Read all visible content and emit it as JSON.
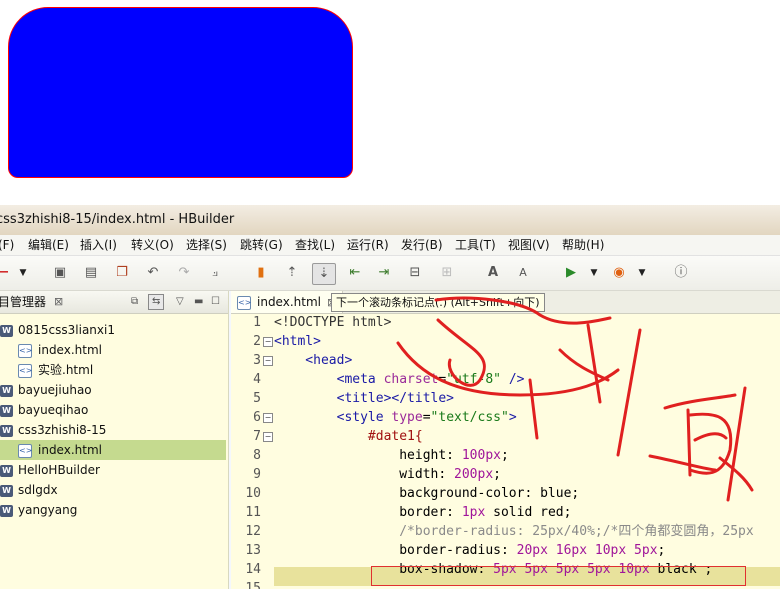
{
  "window": {
    "title": "css3zhishi8-15/index.html  -  HBuilder"
  },
  "menu": [
    "(F)",
    "编辑(E)",
    "插入(I)",
    "转义(O)",
    "选择(S)",
    "跳转(G)",
    "查找(L)",
    "运行(R)",
    "发行(B)",
    "工具(T)",
    "视图(V)",
    "帮助(H)"
  ],
  "toolbar": {
    "icons": [
      "new-file-icon",
      "dropdown-icon",
      "save-icon",
      "save-all-icon",
      "copy-icon",
      "undo-icon",
      "redo-icon",
      "format-icon",
      "bookmark-icon",
      "prev-bookmark-icon",
      "next-bookmark-icon",
      "goto-start-icon",
      "goto-end-icon",
      "comment-icon",
      "uncomment-icon",
      "font-increase-icon",
      "font-decrease-icon",
      "run-icon",
      "dropdown-icon",
      "browser-icon",
      "dropdown-icon",
      "help-icon"
    ],
    "font_increase": "A",
    "font_decrease": "A"
  },
  "explorer": {
    "title": "目管理器",
    "close": "⊠",
    "items": [
      {
        "label": "0815css3lianxi1",
        "type": "project"
      },
      {
        "label": "index.html",
        "type": "file"
      },
      {
        "label": "实验.html",
        "type": "file"
      },
      {
        "label": "bayuejiuhao",
        "type": "project"
      },
      {
        "label": "bayueqihao",
        "type": "project"
      },
      {
        "label": "css3zhishi8-15",
        "type": "project"
      },
      {
        "label": "index.html",
        "type": "file",
        "selected": true
      },
      {
        "label": "HelloHBuilder",
        "type": "project"
      },
      {
        "label": "sdlgdx",
        "type": "project"
      },
      {
        "label": "yangyang",
        "type": "project"
      }
    ]
  },
  "editor": {
    "tab": "index.html",
    "tab_close": "⊠",
    "tooltip": "下一个滚动条标记点(.) (Alt+Shift+向下)",
    "line_numbers": [
      "1",
      "2",
      "3",
      "4",
      "5",
      "6",
      "7",
      "8",
      "9",
      "10",
      "11",
      "12",
      "13",
      "14",
      "15"
    ],
    "lines": [
      [
        {
          "c": "t-doc",
          "t": "<!DOCTYPE html>"
        }
      ],
      [
        {
          "c": "t-tag",
          "t": "<html>"
        }
      ],
      [
        {
          "c": "t-tag",
          "t": "    <head>"
        }
      ],
      [
        {
          "c": "t-tag",
          "t": "        <meta "
        },
        {
          "c": "t-attr",
          "t": "charset"
        },
        {
          "c": "t-prop",
          "t": "="
        },
        {
          "c": "t-str",
          "t": "\"utf-8\""
        },
        {
          "c": "t-tag",
          "t": " />"
        }
      ],
      [
        {
          "c": "t-tag",
          "t": "        <title></title>"
        }
      ],
      [
        {
          "c": "t-tag",
          "t": "        <style "
        },
        {
          "c": "t-attr",
          "t": "type"
        },
        {
          "c": "t-prop",
          "t": "="
        },
        {
          "c": "t-str",
          "t": "\"text/css\""
        },
        {
          "c": "t-tag",
          "t": ">"
        }
      ],
      [
        {
          "c": "t-sel",
          "t": "            #date1{"
        }
      ],
      [
        {
          "c": "t-prop",
          "t": "                height: "
        },
        {
          "c": "t-num",
          "t": "100px"
        },
        {
          "c": "t-prop",
          "t": ";"
        }
      ],
      [
        {
          "c": "t-prop",
          "t": "                width: "
        },
        {
          "c": "t-num",
          "t": "200px"
        },
        {
          "c": "t-prop",
          "t": ";"
        }
      ],
      [
        {
          "c": "t-prop",
          "t": "                background-color: blue;"
        }
      ],
      [
        {
          "c": "t-prop",
          "t": "                border: "
        },
        {
          "c": "t-num",
          "t": "1px"
        },
        {
          "c": "t-prop",
          "t": " solid red;"
        }
      ],
      [
        {
          "c": "t-cmt",
          "t": "                /*border-radius: 25px/40%;/*四个角都变圆角，25px"
        }
      ],
      [
        {
          "c": "t-prop",
          "t": "                border-radius: "
        },
        {
          "c": "t-num",
          "t": "20px 16px 10px 5px"
        },
        {
          "c": "t-prop",
          "t": ";"
        }
      ],
      [
        {
          "c": "t-prop",
          "t": "                box-shadow: "
        },
        {
          "c": "t-num",
          "t": "5px 5px 5px 5px 10px"
        },
        {
          "c": "t-prop",
          "t": " black ;"
        }
      ],
      [
        {
          "c": "t-prop",
          "t": ""
        }
      ]
    ]
  },
  "colors": {
    "demo_fill": "#0000ff",
    "demo_border": "#ff0000",
    "annotation": "#e02020",
    "editor_bg": "#fffde0",
    "highlight": "#e8e29c"
  }
}
